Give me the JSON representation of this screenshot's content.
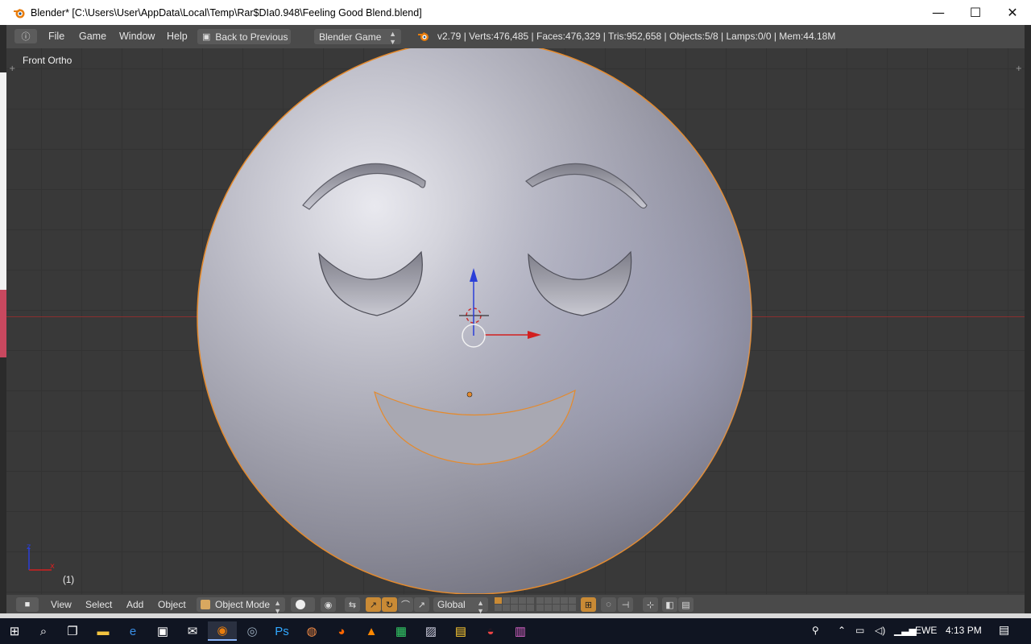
{
  "window": {
    "title": "Blender* [C:\\Users\\User\\AppData\\Local\\Temp\\Rar$DIa0.948\\Feeling Good Blend.blend]",
    "minimize_glyph": "—",
    "maximize_glyph": "☐",
    "close_glyph": "✕"
  },
  "info_header": {
    "editor_glyph": "ⓘ",
    "menus": [
      "File",
      "Game",
      "Window",
      "Help"
    ],
    "back_button": "Back to Previous",
    "engine": "Blender Game",
    "stats": "v2.79 | Verts:476,485 | Faces:476,329 | Tris:952,658 | Objects:5/8 | Lamps:0/0 | Mem:44.18M"
  },
  "viewport": {
    "view_label": "Front Ortho",
    "frame_label": "(1)",
    "plus": "+"
  },
  "bottom_header": {
    "menus": [
      "View",
      "Select",
      "Add",
      "Object"
    ],
    "mode": "Object Mode",
    "orientation": "Global"
  },
  "taskbar": {
    "lang": "EWE",
    "time": "4:13 PM"
  },
  "colors": {
    "selection_outline": "#e58a2c",
    "axis_x": "#d22020",
    "axis_z": "#2a3fd8",
    "accent": "#c98a35"
  }
}
